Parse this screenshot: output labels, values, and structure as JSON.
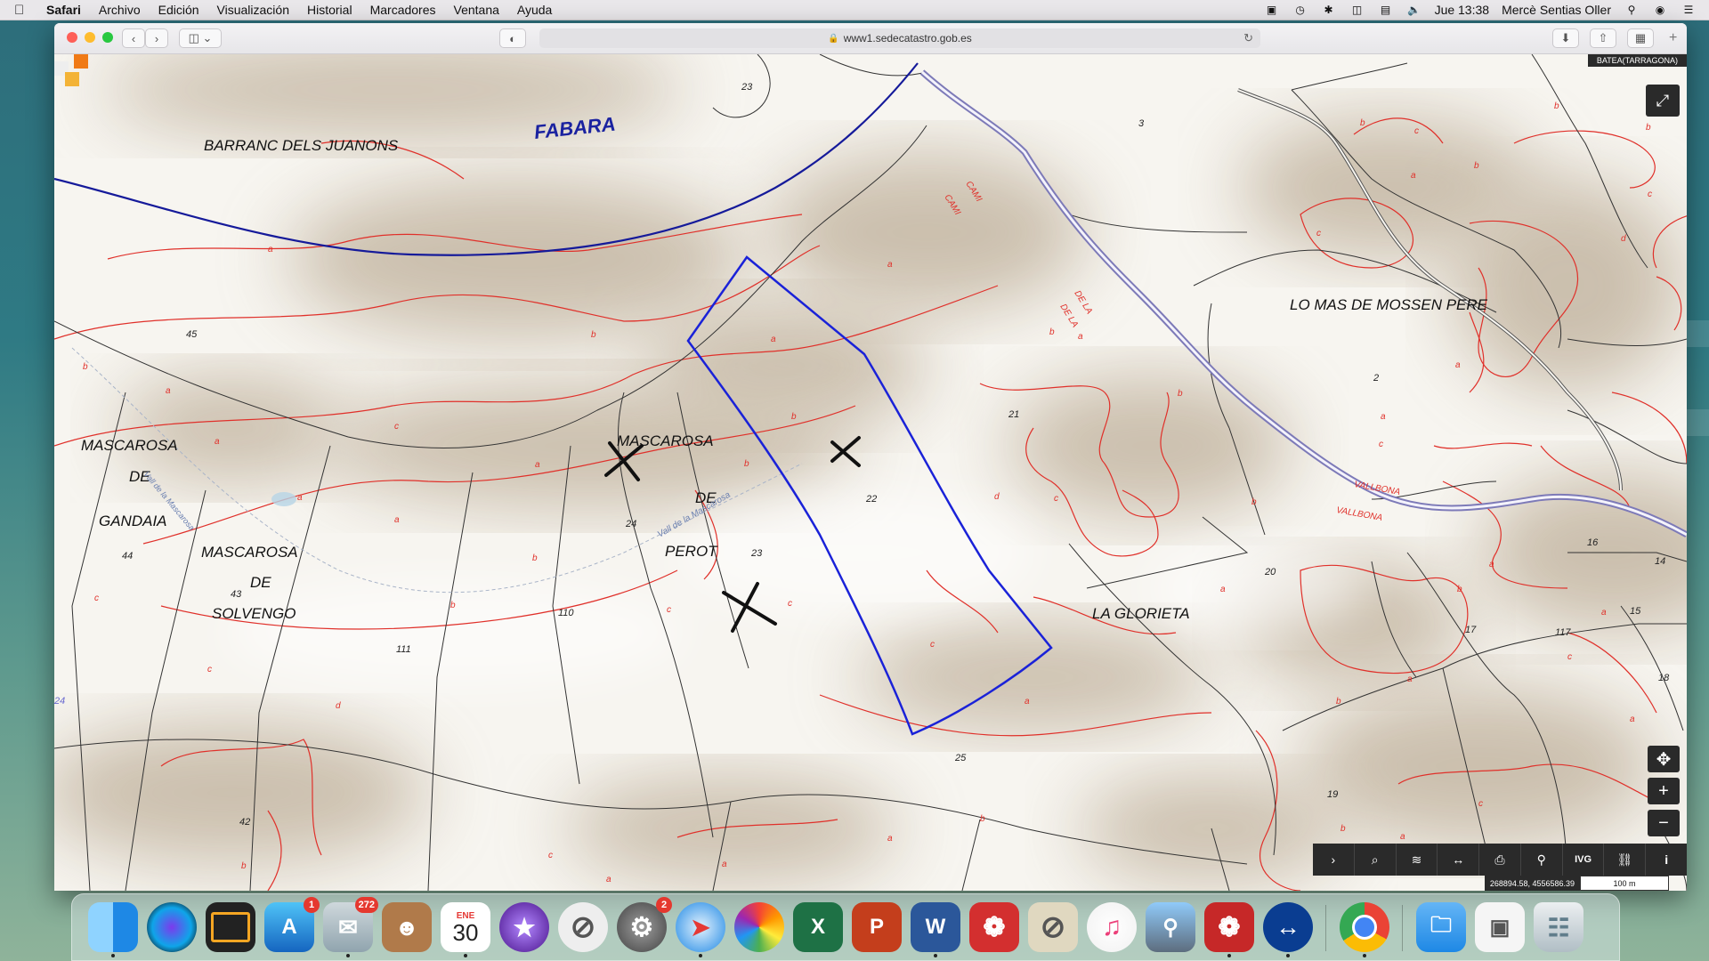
{
  "menubar": {
    "app": "Safari",
    "items": [
      "Archivo",
      "Edición",
      "Visualización",
      "Historial",
      "Marcadores",
      "Ventana",
      "Ayuda"
    ],
    "datetime": "Jue 13:38",
    "user": "Mercè Sentias Oller"
  },
  "browser": {
    "url": "www1.sedecatastro.gob.es"
  },
  "map": {
    "badge": "BATEA(TARRAGONA)",
    "place_labels": {
      "barranc": "BARRANC DELS JUANONS",
      "fabara": "FABARA",
      "mas_mossen": "LO MAS DE MOSSEN PERE",
      "glorieta": "LA GLORIETA",
      "mascarosa": "MASCAROSA",
      "de": "DE",
      "gandaia": "GANDAIA",
      "solvengo": "SOLVENGO",
      "perot": "PEROT"
    },
    "road_labels": {
      "cami1": "CAMI",
      "cami2": "CAMI",
      "dela1": "DE LA",
      "dela2": "DE LA",
      "vallbona1": "VALLBONA",
      "vallbona2": "VALLBONA",
      "valldela1": "Vall de la Mascarosa",
      "valldela2": "Vall de la Mascarosa"
    },
    "parcel_numbers": {
      "n23a": "23",
      "n3": "3",
      "n45": "45",
      "n21": "21",
      "n22": "22",
      "n24": "24",
      "n23b": "23",
      "n44": "44",
      "n43": "43",
      "n110": "110",
      "n111": "111",
      "n20": "20",
      "n16": "16",
      "n14": "14",
      "n15": "15",
      "n17": "17",
      "n117": "117",
      "n18": "18",
      "n19": "19",
      "n42": "42",
      "n25": "25",
      "n2": "2",
      "n24edge": "24"
    },
    "subparcel_letters": [
      "a",
      "b",
      "c",
      "d"
    ],
    "coords": "268894.58, 4556586.39",
    "scale": "100 m",
    "tools": [
      "›",
      "⌕",
      "≋",
      "↔",
      "⎙",
      "⚲",
      "IVG",
      "⛓",
      "i"
    ],
    "zoom": {
      "locate": "✥",
      "plus": "+",
      "minus": "−"
    },
    "fullscreen": "⤢"
  },
  "dock": {
    "badges": {
      "appstore": "1",
      "mail": "272",
      "prefs": "2"
    },
    "calendar": {
      "month": "ENE",
      "day": "30"
    },
    "letters": {
      "excel": "X",
      "powerpoint": "P",
      "word": "W"
    }
  },
  "colors": {
    "parcel": "#e0302a",
    "selection": "#1a22d8",
    "municipal": "#151a9a",
    "road": "#7d7ab8",
    "dock_bg": "#d2e1de"
  }
}
